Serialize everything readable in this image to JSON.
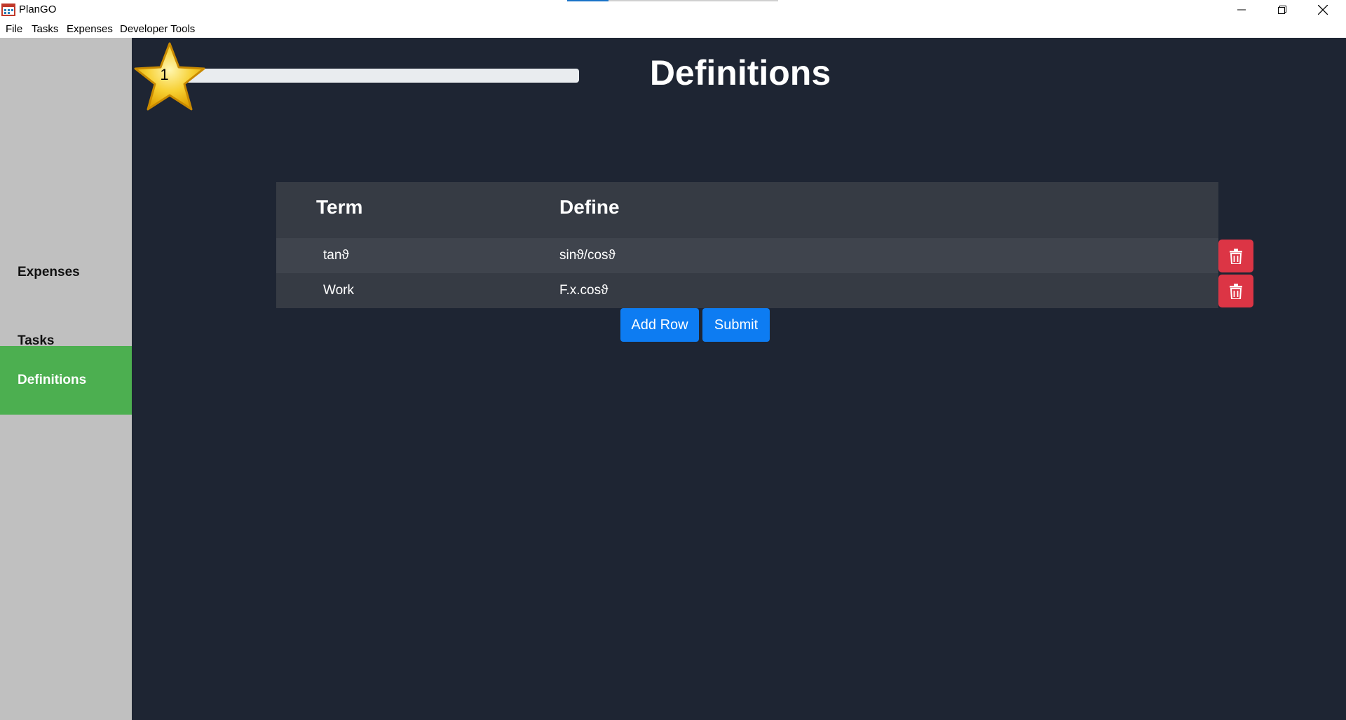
{
  "window": {
    "title": "PlanGO"
  },
  "menu": {
    "items": [
      "File",
      "Tasks",
      "Expenses",
      "Developer Tools"
    ]
  },
  "sidebar": {
    "items": [
      {
        "label": "Expenses",
        "active": false
      },
      {
        "label": "Tasks",
        "active": false
      },
      {
        "label": "Definitions",
        "active": true
      }
    ]
  },
  "progress": {
    "level": "1",
    "fill_percent": 0
  },
  "page": {
    "title": "Definitions"
  },
  "table": {
    "headers": [
      "Term",
      "Define"
    ],
    "rows": [
      {
        "term": "tanϑ",
        "define": "sinϑ/cosϑ"
      },
      {
        "term": "Work",
        "define": "F.x.cosϑ"
      }
    ]
  },
  "actions": {
    "add_row_label": "Add Row",
    "submit_label": "Submit"
  },
  "colors": {
    "background": "#1e2533",
    "sidebar": "#c0c0c0",
    "active_nav": "#4caf50",
    "danger": "#dc3545",
    "primary": "#0d7cf2"
  },
  "icons": [
    "app-icon",
    "minimize-icon",
    "restore-icon",
    "close-icon",
    "star-icon",
    "trash-icon"
  ]
}
